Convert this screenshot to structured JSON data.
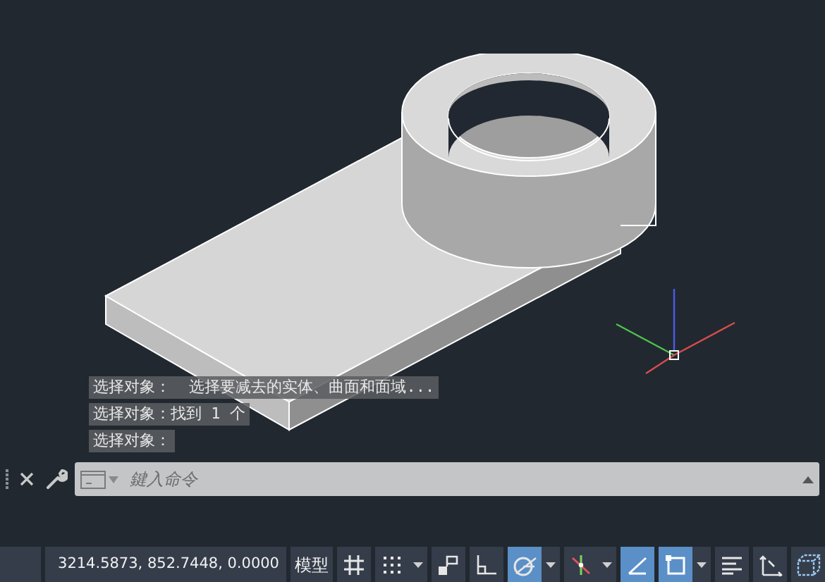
{
  "command_history": [
    "选择对象：  选择要减去的实体、曲面和面域...",
    "选择对象：找到 1 个",
    "选择对象："
  ],
  "command_line": {
    "placeholder": "鍵入命令"
  },
  "status_bar": {
    "coordinates": "3214.5873, 852.7448, 0.0000",
    "space": "模型",
    "tools": [
      {
        "kind": "grid",
        "on": false,
        "menu": false
      },
      {
        "kind": "snap",
        "on": false,
        "menu": true
      },
      {
        "kind": "infer",
        "on": false,
        "menu": false
      },
      {
        "kind": "ortho",
        "on": false,
        "menu": false
      },
      {
        "kind": "polar",
        "on": true,
        "menu": true
      },
      {
        "kind": "iso",
        "on": false,
        "menu": true
      },
      {
        "kind": "track",
        "on": true,
        "menu": false
      },
      {
        "kind": "osnap",
        "on": true,
        "menu": true
      },
      {
        "kind": "lineweight",
        "on": false,
        "menu": false
      },
      {
        "kind": "ucs",
        "on": false,
        "menu": false
      },
      {
        "kind": "cube",
        "on": false,
        "menu": false
      }
    ]
  }
}
